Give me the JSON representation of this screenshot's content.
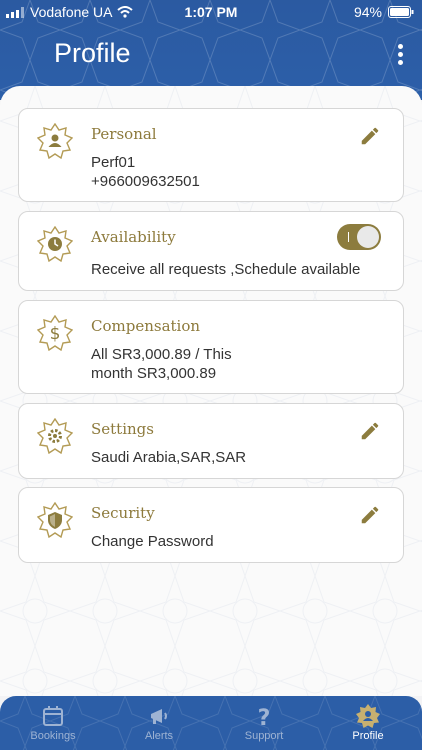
{
  "status_bar": {
    "carrier": "Vodafone UA",
    "time": "1:07 PM",
    "battery": "94%"
  },
  "header": {
    "title": "Profile"
  },
  "cards": {
    "personal": {
      "title": "Personal",
      "name": "Perf01",
      "phone": "+966009632501"
    },
    "availability": {
      "title": "Availability",
      "text": "Receive all requests ,Schedule available",
      "toggle_on": true
    },
    "compensation": {
      "title": "Compensation",
      "line1": "All SR3,000.89 / This",
      "line2": "month SR3,000.89"
    },
    "settings": {
      "title": "Settings",
      "text": "Saudi Arabia,SAR,SAR"
    },
    "security": {
      "title": "Security",
      "text": "Change Password"
    }
  },
  "tabbar": {
    "items": [
      {
        "label": "Bookings",
        "icon": "calendar-icon"
      },
      {
        "label": "Alerts",
        "icon": "megaphone-icon"
      },
      {
        "label": "Support",
        "icon": "question-icon"
      },
      {
        "label": "Profile",
        "icon": "profile-star-icon"
      }
    ],
    "active": "Profile"
  },
  "colors": {
    "header_blue": "#2c5ea7",
    "accent_gold": "#8c7c3e"
  }
}
